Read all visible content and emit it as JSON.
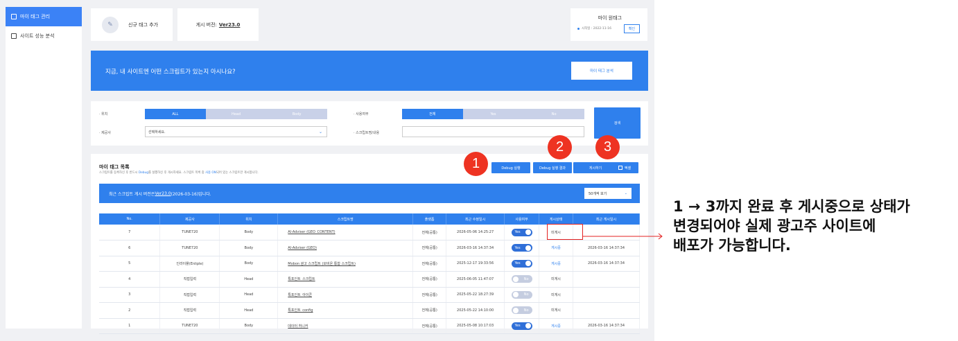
{
  "sidebar": {
    "items": [
      {
        "label": "마이 태그 관리",
        "active": true
      },
      {
        "label": "사이트 성능 분석",
        "active": false
      }
    ]
  },
  "top": {
    "add_label": "신규 태그 추가",
    "version_prefix": "게시 버전:",
    "version_value": "Ver23.0",
    "onetag_title": "마이 원태그",
    "onetag_start": "시작일 : 2022-11-16",
    "onetag_confirm": "확인"
  },
  "banner": {
    "text": "지금, 내 사이트엔 어떤 스크립트가 있는지 아시나요?",
    "button": "마이 태그 분석"
  },
  "filter": {
    "position_label": "· 위치",
    "position_options": [
      "ALL",
      "Head",
      "Body"
    ],
    "usage_label": "· 사용여부",
    "usage_options": [
      "전체",
      "Yes",
      "No"
    ],
    "provider_label": "· 제공사",
    "provider_placeholder": "선택하세요.",
    "script_label": "· 스크립트명/내용",
    "script_value": "",
    "search_button": "검색"
  },
  "list": {
    "title": "마이 태그 목록",
    "desc_a": "스크립트를 등록하신 후 반드시 ",
    "desc_debug": "Debug",
    "desc_b": "를 실행하신 후 게시하세요. 스크립트 목록 중 ",
    "desc_on": "사용 ON",
    "desc_c": "되어 있는 스크립트만 게시합니다.",
    "btn_debug": "Debug 실행",
    "btn_debug_result": "Debug 실행 결과",
    "btn_publish": "게시하기",
    "btn_excel": "엑셀",
    "circles": [
      "1",
      "2",
      "3"
    ],
    "version_bar_a": "최근 스크립트 게시 버전은 ",
    "version_bar_ver": "Ver23.0",
    "version_bar_b": "(2026-03-16)입니다.",
    "page_size": "50개씩 보기",
    "columns": [
      "No.",
      "제공사",
      "위치",
      "스크립트명",
      "플랫폼",
      "최근 수정일시",
      "사용여부",
      "게시상태",
      "최근 게시일시"
    ],
    "rows": [
      {
        "no": "7",
        "provider": "TUNE720",
        "pos": "Body",
        "name": "AI-Adviser (GEO_CONTENT)",
        "platform": "전체(공통)",
        "modified": "2026-05-06 14:25:27",
        "use": "Yes",
        "status": "미게시",
        "published": ""
      },
      {
        "no": "6",
        "provider": "TUNE720",
        "pos": "Body",
        "name": "AI-Adviser (GEO)",
        "platform": "전체(공통)",
        "modified": "2026-03-16 14:37:34",
        "use": "Yes",
        "status": "게시중",
        "published": "2026-03-16 14:37:34"
      },
      {
        "no": "5",
        "provider": "인라이플(Enliple)",
        "pos": "Body",
        "name": "Mobon 광고 스크립트 (모비온 통합 스크립트)",
        "platform": "전체(공통)",
        "modified": "2025-12-17 19:33:56",
        "use": "Yes",
        "status": "게시중",
        "published": "2026-03-16 14:37:34"
      },
      {
        "no": "4",
        "provider": "직접입력",
        "pos": "Head",
        "name": "특포인트_스크립트",
        "platform": "전체(공통)",
        "modified": "2025-06-05 11:47:07",
        "use": "No",
        "status": "미게시",
        "published": ""
      },
      {
        "no": "3",
        "provider": "직접입력",
        "pos": "Head",
        "name": "특포인트_아이콘",
        "platform": "전체(공통)",
        "modified": "2025-05-22 18:27:39",
        "use": "No",
        "status": "미게시",
        "published": ""
      },
      {
        "no": "2",
        "provider": "직접입력",
        "pos": "Head",
        "name": "특포인트_config",
        "platform": "전체(공통)",
        "modified": "2025-05-22 14:10:00",
        "use": "No",
        "status": "미게시",
        "published": ""
      },
      {
        "no": "1",
        "provider": "TUNE720",
        "pos": "Body",
        "name": "데이터 허니커",
        "platform": "전체(공통)",
        "modified": "2025-05-08 10:17:03",
        "use": "Yes",
        "status": "게시중",
        "published": "2026-03-16 14:37:34"
      }
    ]
  },
  "annotation": {
    "line1": "1 → 3까지 완료 후 게시중으로 상태가",
    "line2": "변경되어야 실제 광고주 사이트에",
    "line3": "배포가 가능합니다."
  },
  "colors": {
    "accent": "#2f80ed",
    "highlight": "#e32222"
  }
}
